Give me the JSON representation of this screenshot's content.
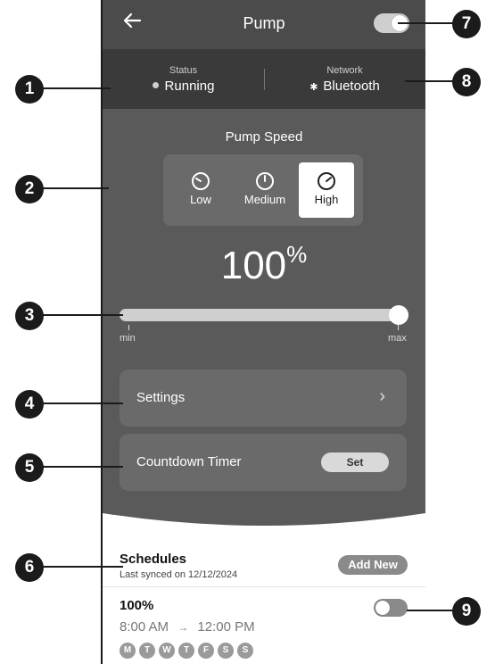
{
  "header": {
    "title": "Pump",
    "back_icon": "arrow-left-icon",
    "power_toggle": {
      "on": true
    }
  },
  "status": {
    "label": "Status",
    "value": "Running"
  },
  "network": {
    "label": "Network",
    "value": "Bluetooth",
    "icon": "bluetooth-icon"
  },
  "pump_speed": {
    "title": "Pump Speed",
    "options": [
      {
        "label": "Low",
        "icon": "gauge-low-icon"
      },
      {
        "label": "Medium",
        "icon": "gauge-medium-icon"
      },
      {
        "label": "High",
        "icon": "gauge-high-icon",
        "active": true
      }
    ],
    "percent": "100",
    "percent_symbol": "%",
    "slider": {
      "min_label": "min",
      "max_label": "max",
      "value_fraction": 1.0
    }
  },
  "menu": {
    "settings_label": "Settings",
    "countdown_label": "Countdown Timer",
    "set_button": "Set"
  },
  "schedules": {
    "title": "Schedules",
    "last_synced": "Last synced on 12/12/2024",
    "add_button": "Add New",
    "items": [
      {
        "title": "100%",
        "start": "8:00 AM",
        "arrow": "→",
        "end": "12:00 PM",
        "enabled": false,
        "days": [
          "M",
          "T",
          "W",
          "T",
          "F",
          "S",
          "S"
        ]
      }
    ]
  },
  "callouts": [
    "1",
    "2",
    "3",
    "4",
    "5",
    "6",
    "7",
    "8",
    "9"
  ],
  "colors": {
    "header": "#4b4b4b",
    "status_bar": "#3a3a3a",
    "panel": "#5a5a5a",
    "card": "#6a6a6a",
    "accent": "#ffffff"
  }
}
